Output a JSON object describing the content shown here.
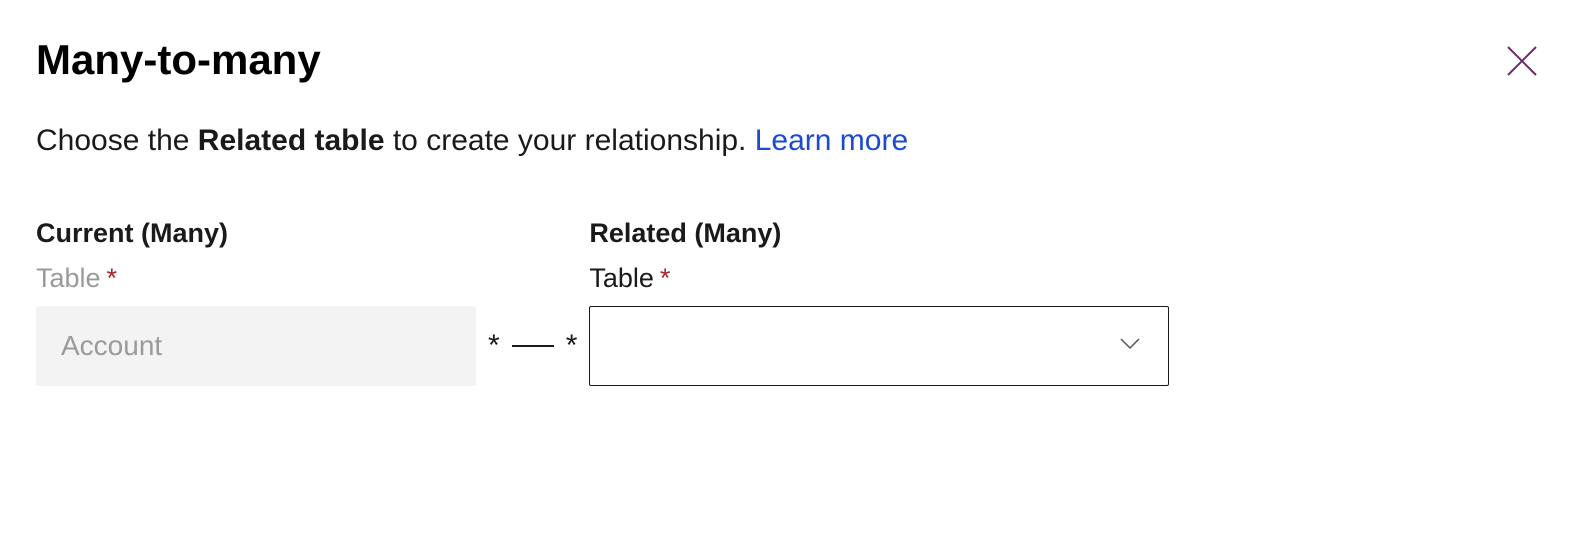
{
  "header": {
    "title": "Many-to-many"
  },
  "description": {
    "prefix": "Choose the ",
    "bold": "Related table",
    "suffix": " to create your relationship. ",
    "link": "Learn more"
  },
  "current": {
    "section_title": "Current (Many)",
    "field_label": "Table",
    "required_mark": "*",
    "value": "Account"
  },
  "connector": {
    "left": "*",
    "right": "*"
  },
  "related": {
    "section_title": "Related (Many)",
    "field_label": "Table",
    "required_mark": "*",
    "value": ""
  }
}
